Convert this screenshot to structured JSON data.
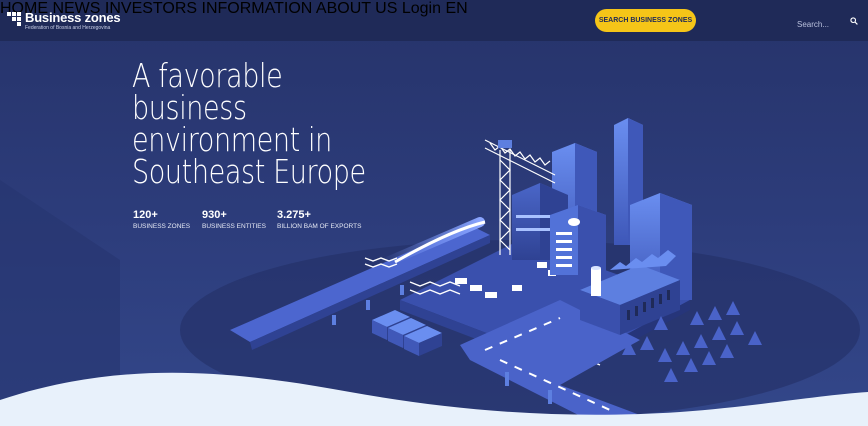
{
  "header": {
    "logo_title": "Business zones",
    "logo_subtitle": "Federation of Bosnia and Herzegovina",
    "nav": [
      "HOME",
      "NEWS",
      "INVESTORS",
      "INFORMATION",
      "ABOUT US"
    ],
    "cta_label": "SEARCH BUSINESS ZONES",
    "login_label": "Login",
    "language_label": "EN",
    "search_placeholder": "Search..."
  },
  "hero": {
    "headline_lines": [
      "A favorable",
      "business",
      "environment in",
      "Southeast Europe"
    ],
    "stats": [
      {
        "value": "120+",
        "label": "BUSINESS ZONES"
      },
      {
        "value": "930+",
        "label": "BUSINESS ENTITIES"
      },
      {
        "value": "3.275+",
        "label": "BILLION BAM OF EXPORTS"
      }
    ]
  },
  "colors": {
    "header_bg": "#1f2a58",
    "hero_bg": "#2d3d7c",
    "accent": "#f5c518",
    "building_light": "#5d7fe0",
    "wave": "#e8f1fb"
  },
  "icons": {
    "search": "search-icon",
    "logo": "logo-mark-icon"
  }
}
